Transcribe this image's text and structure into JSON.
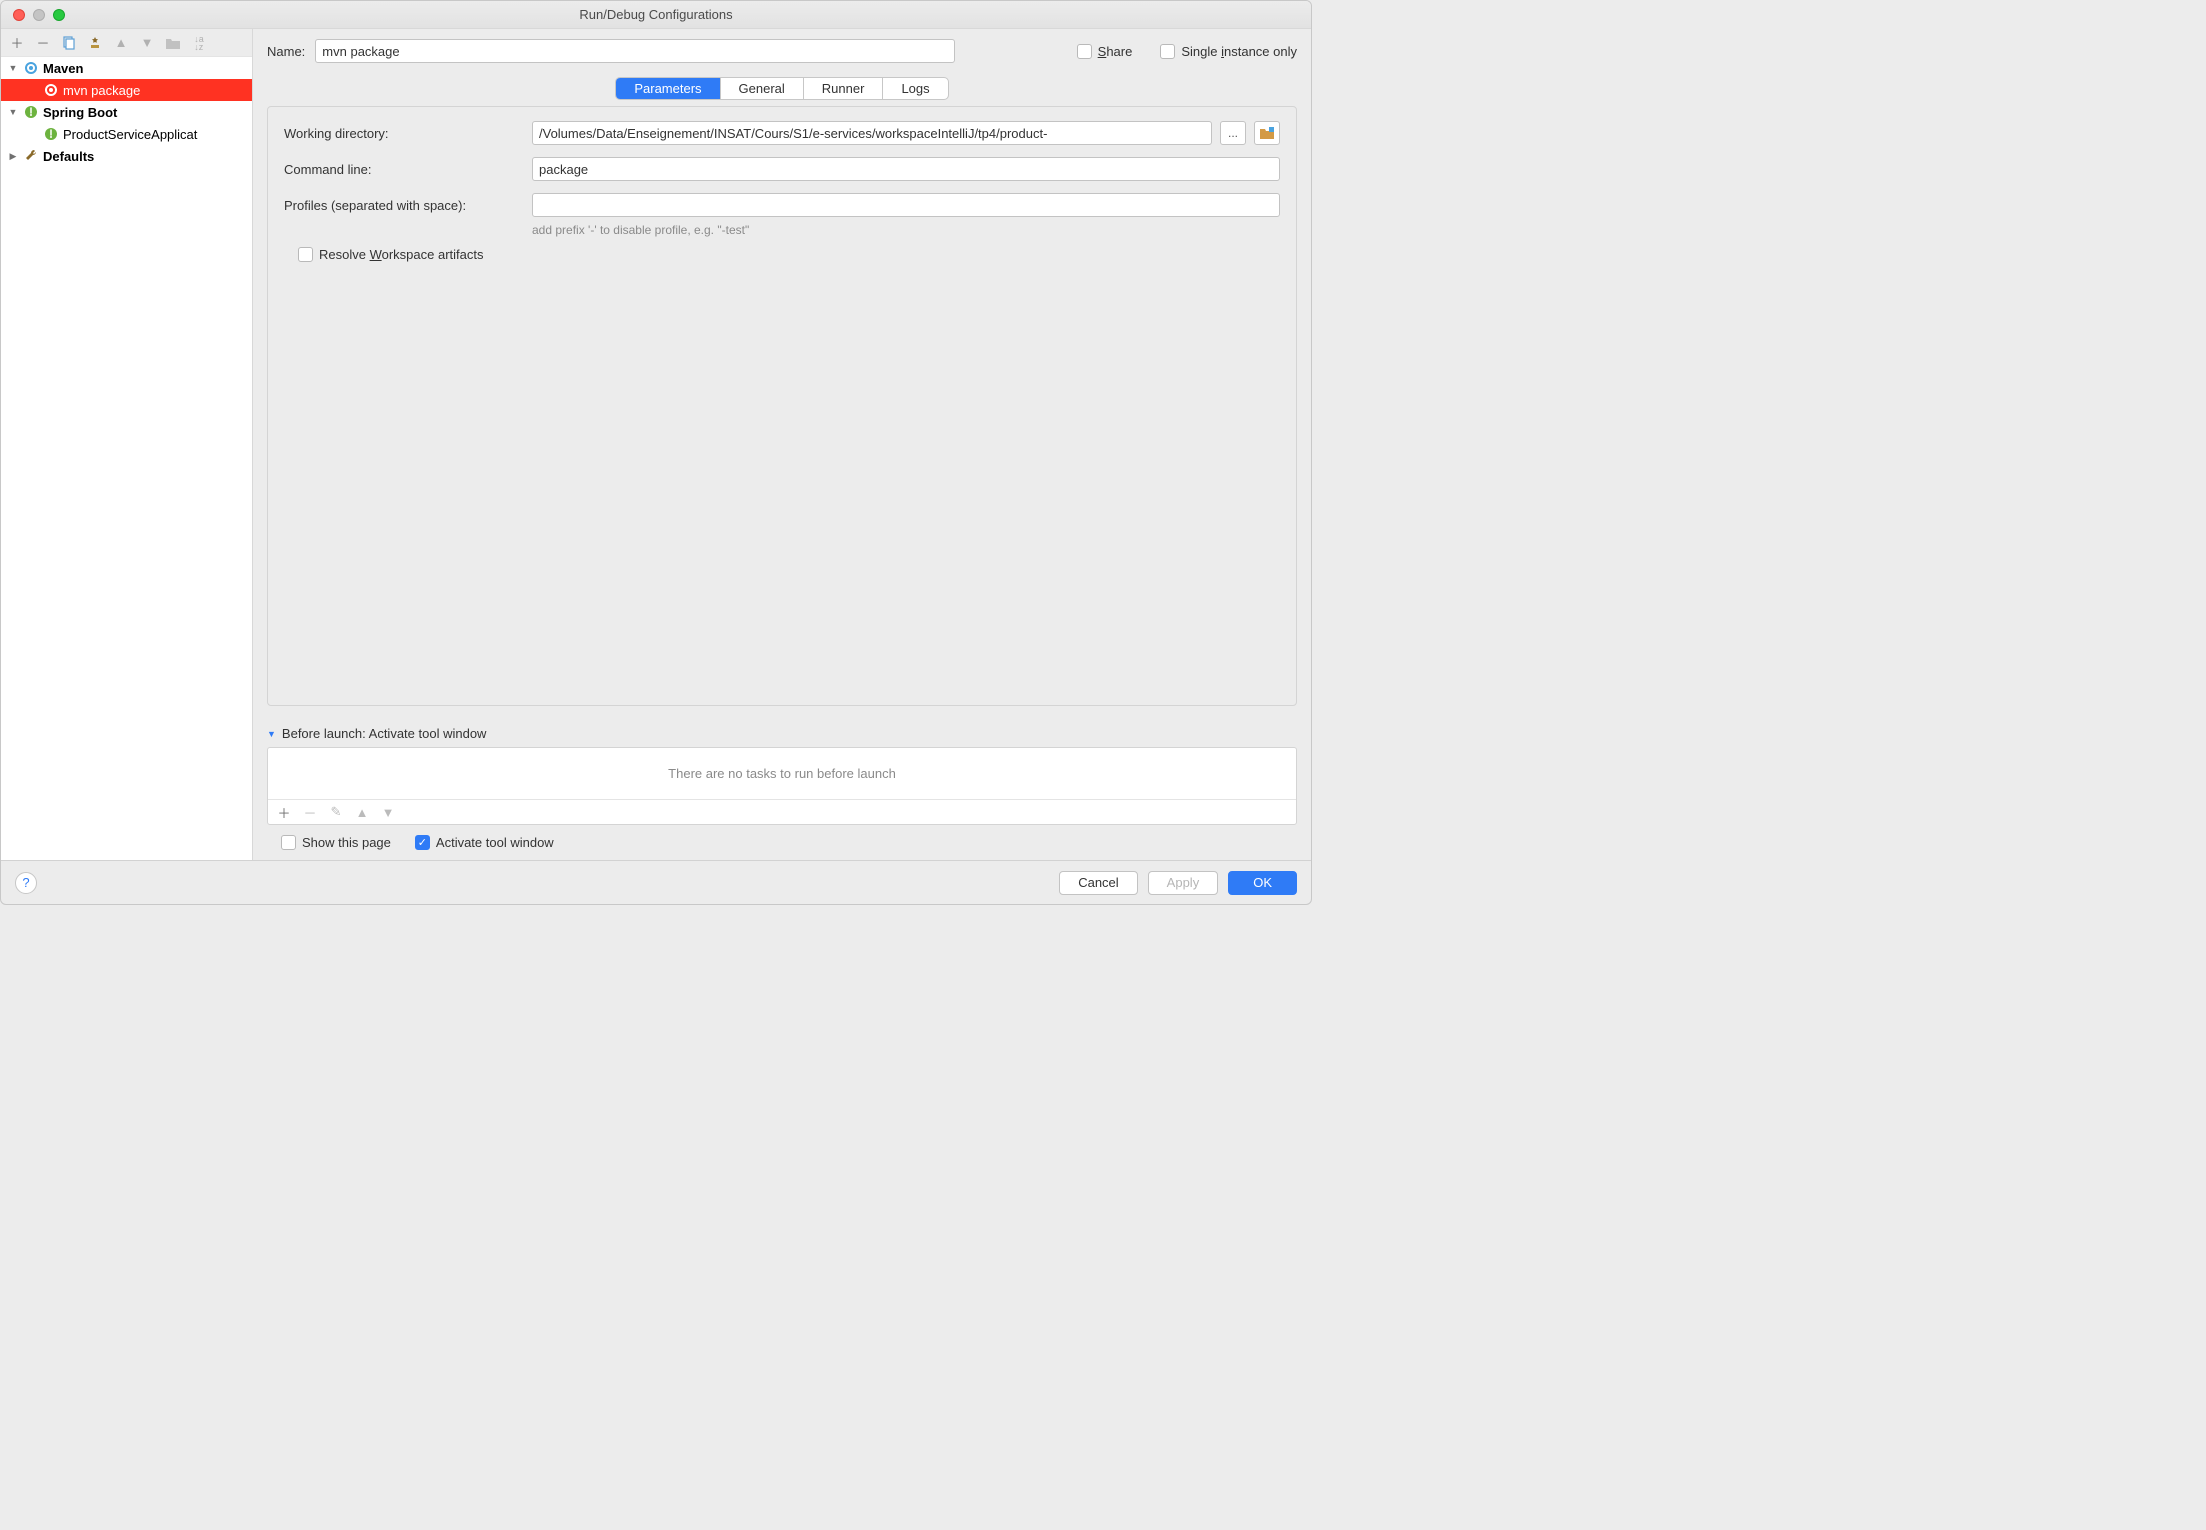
{
  "window": {
    "title": "Run/Debug Configurations"
  },
  "sidebar": {
    "nodes": {
      "maven": "Maven",
      "mvn_package": "mvn package",
      "spring_boot": "Spring Boot",
      "product_app": "ProductServiceApplicat",
      "defaults": "Defaults"
    }
  },
  "header": {
    "name_label": "Name:",
    "name_value": "mvn package",
    "share_label": "hare",
    "single_instance_label": "nstance only"
  },
  "tabs": {
    "parameters": "Parameters",
    "general": "General",
    "runner": "Runner",
    "logs": "Logs"
  },
  "form": {
    "wd_label": "Working directory:",
    "wd_value": "/Volumes/Data/Enseignement/INSAT/Cours/S1/e-services/workspaceIntelliJ/tp4/product-",
    "cmd_label": "Command line:",
    "cmd_value": "package",
    "profiles_label": "Profiles (separated with space):",
    "profiles_value": "",
    "profiles_hint": "add prefix '-' to disable profile, e.g. \"-test\"",
    "resolve_label": "orkspace artifacts",
    "resolve_prefix": "Resolve "
  },
  "before": {
    "header": "Before launch: Activate tool window",
    "empty": "There are no tasks to run before launch",
    "show_page": "Show this page",
    "activate": "Activate tool window"
  },
  "buttons": {
    "cancel": "Cancel",
    "apply": "Apply",
    "ok": "OK",
    "browse": "..."
  }
}
